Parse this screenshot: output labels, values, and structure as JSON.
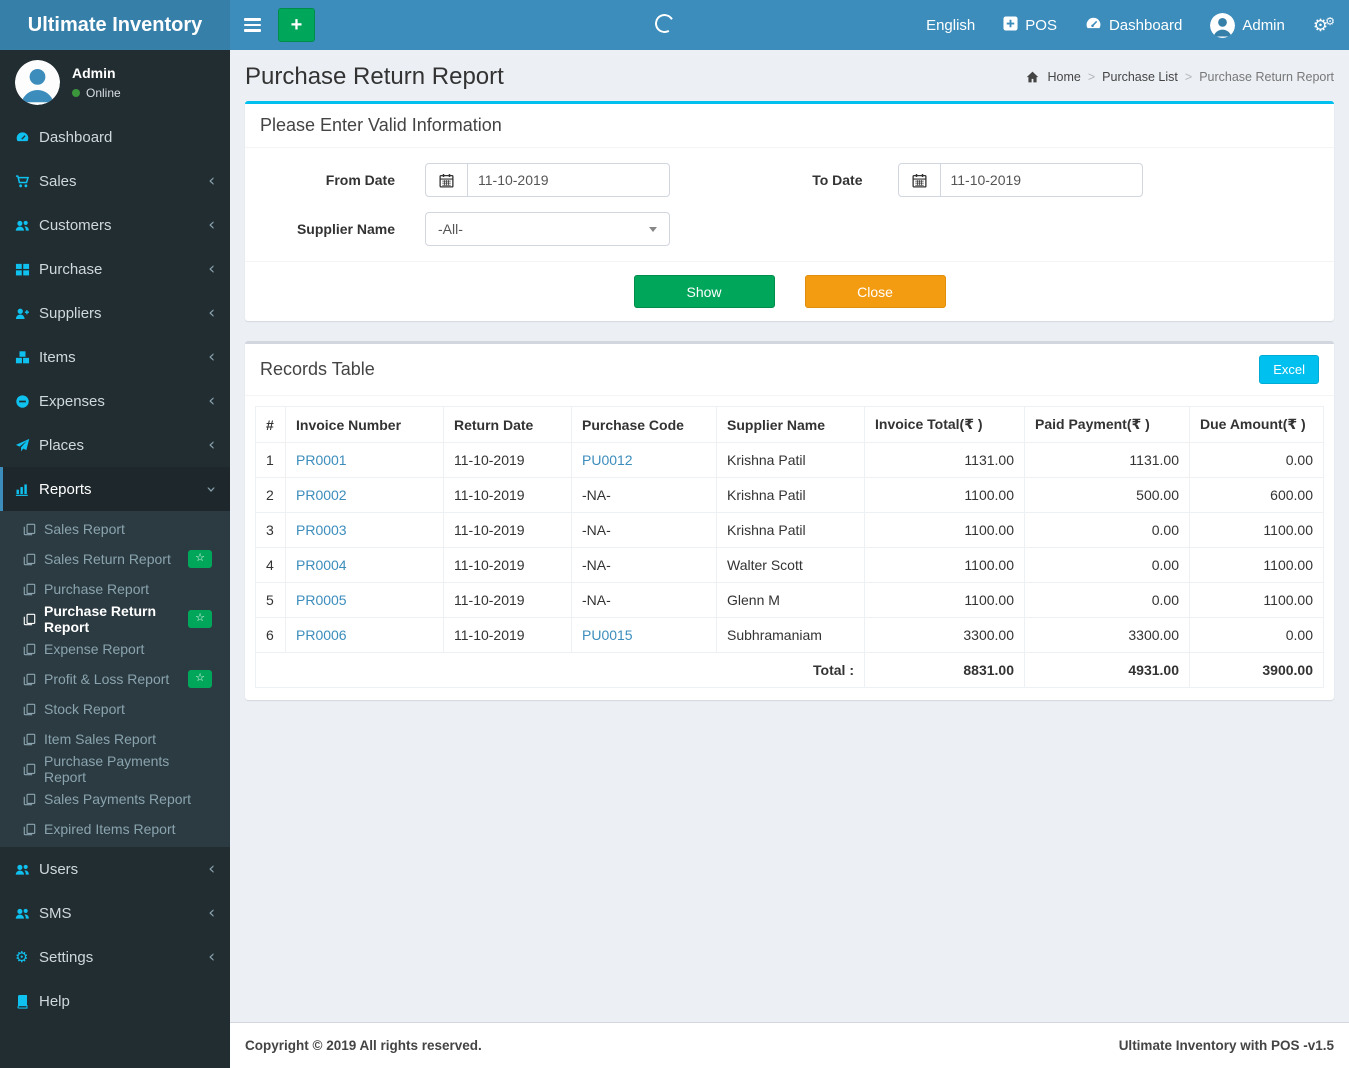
{
  "navbar": {
    "brand": "Ultimate Inventory",
    "quick_add": "+",
    "english": "English",
    "pos": "POS",
    "dashboard": "Dashboard",
    "user": "Admin"
  },
  "sidebar": {
    "user": {
      "name": "Admin",
      "status": "Online"
    },
    "items": [
      {
        "label": "Dashboard",
        "icon": "tachometer-icon",
        "chevron": false
      },
      {
        "label": "Sales",
        "icon": "cart-icon",
        "chevron": "left"
      },
      {
        "label": "Customers",
        "icon": "users-icon",
        "chevron": "left"
      },
      {
        "label": "Purchase",
        "icon": "grid-icon",
        "chevron": "left"
      },
      {
        "label": "Suppliers",
        "icon": "user-plus-icon",
        "chevron": "left"
      },
      {
        "label": "Items",
        "icon": "cubes-icon",
        "chevron": "left"
      },
      {
        "label": "Expenses",
        "icon": "minus-circle-icon",
        "chevron": "left"
      },
      {
        "label": "Places",
        "icon": "paper-plane-icon",
        "chevron": "left"
      },
      {
        "label": "Reports",
        "icon": "bar-chart-icon",
        "chevron": "down",
        "active": true,
        "submenu": [
          {
            "label": "Sales Report"
          },
          {
            "label": "Sales Return Report",
            "badge": "star"
          },
          {
            "label": "Purchase Report"
          },
          {
            "label": "Purchase Return Report",
            "badge": "star",
            "active": true
          },
          {
            "label": "Expense Report"
          },
          {
            "label": "Profit & Loss Report",
            "badge": "star"
          },
          {
            "label": "Stock Report"
          },
          {
            "label": "Item Sales Report"
          },
          {
            "label": "Purchase Payments Report"
          },
          {
            "label": "Sales Payments Report"
          },
          {
            "label": "Expired Items Report"
          }
        ]
      },
      {
        "label": "Users",
        "icon": "users-icon",
        "chevron": "left"
      },
      {
        "label": "SMS",
        "icon": "users-icon",
        "chevron": "left"
      },
      {
        "label": "Settings",
        "icon": "gears-icon",
        "chevron": "left"
      },
      {
        "label": "Help",
        "icon": "book-icon",
        "chevron": false
      }
    ]
  },
  "page": {
    "title": "Purchase Return Report",
    "breadcrumb": [
      "Home",
      "Purchase List",
      "Purchase Return Report"
    ]
  },
  "filter": {
    "heading": "Please Enter Valid Information",
    "from_label": "From Date",
    "from_value": "11-10-2019",
    "to_label": "To Date",
    "to_value": "11-10-2019",
    "supplier_label": "Supplier Name",
    "supplier_value": "-All-",
    "show": "Show",
    "close": "Close"
  },
  "records": {
    "heading": "Records Table",
    "excel": "Excel",
    "columns": [
      "#",
      "Invoice Number",
      "Return Date",
      "Purchase Code",
      "Supplier Name",
      "Invoice Total(₹ )",
      "Paid Payment(₹ )",
      "Due Amount(₹ )"
    ],
    "rows": [
      {
        "num": "1",
        "invoice": "PR0001",
        "return_date": "11-10-2019",
        "purchase_code": "PU0012",
        "purchase_code_link": true,
        "supplier": "Krishna Patil",
        "invoice_total": "1131.00",
        "paid": "1131.00",
        "due": "0.00"
      },
      {
        "num": "2",
        "invoice": "PR0002",
        "return_date": "11-10-2019",
        "purchase_code": "-NA-",
        "purchase_code_link": false,
        "supplier": "Krishna Patil",
        "invoice_total": "1100.00",
        "paid": "500.00",
        "due": "600.00"
      },
      {
        "num": "3",
        "invoice": "PR0003",
        "return_date": "11-10-2019",
        "purchase_code": "-NA-",
        "purchase_code_link": false,
        "supplier": "Krishna Patil",
        "invoice_total": "1100.00",
        "paid": "0.00",
        "due": "1100.00"
      },
      {
        "num": "4",
        "invoice": "PR0004",
        "return_date": "11-10-2019",
        "purchase_code": "-NA-",
        "purchase_code_link": false,
        "supplier": "Walter Scott",
        "invoice_total": "1100.00",
        "paid": "0.00",
        "due": "1100.00"
      },
      {
        "num": "5",
        "invoice": "PR0005",
        "return_date": "11-10-2019",
        "purchase_code": "-NA-",
        "purchase_code_link": false,
        "supplier": "Glenn M",
        "invoice_total": "1100.00",
        "paid": "0.00",
        "due": "1100.00"
      },
      {
        "num": "6",
        "invoice": "PR0006",
        "return_date": "11-10-2019",
        "purchase_code": "PU0015",
        "purchase_code_link": true,
        "supplier": "Subhramaniam",
        "invoice_total": "3300.00",
        "paid": "3300.00",
        "due": "0.00"
      }
    ],
    "total_label": "Total :",
    "total_invoice": "8831.00",
    "total_paid": "4931.00",
    "total_due": "3900.00"
  },
  "footer": {
    "left": "Copyright © 2019 All rights reserved.",
    "right": "Ultimate Inventory with POS -v1.5"
  },
  "colors": {
    "navbar": "#3c8dbc",
    "brand-bg": "#367fa9",
    "sidebar": "#222d32",
    "submenu": "#2c3b41",
    "accent": "#00c0ef",
    "green": "#00a65a",
    "orange": "#f39c12",
    "link": "#3c8dbc",
    "content-bg": "#ecf0f5",
    "icon": "#0fc1ef"
  }
}
